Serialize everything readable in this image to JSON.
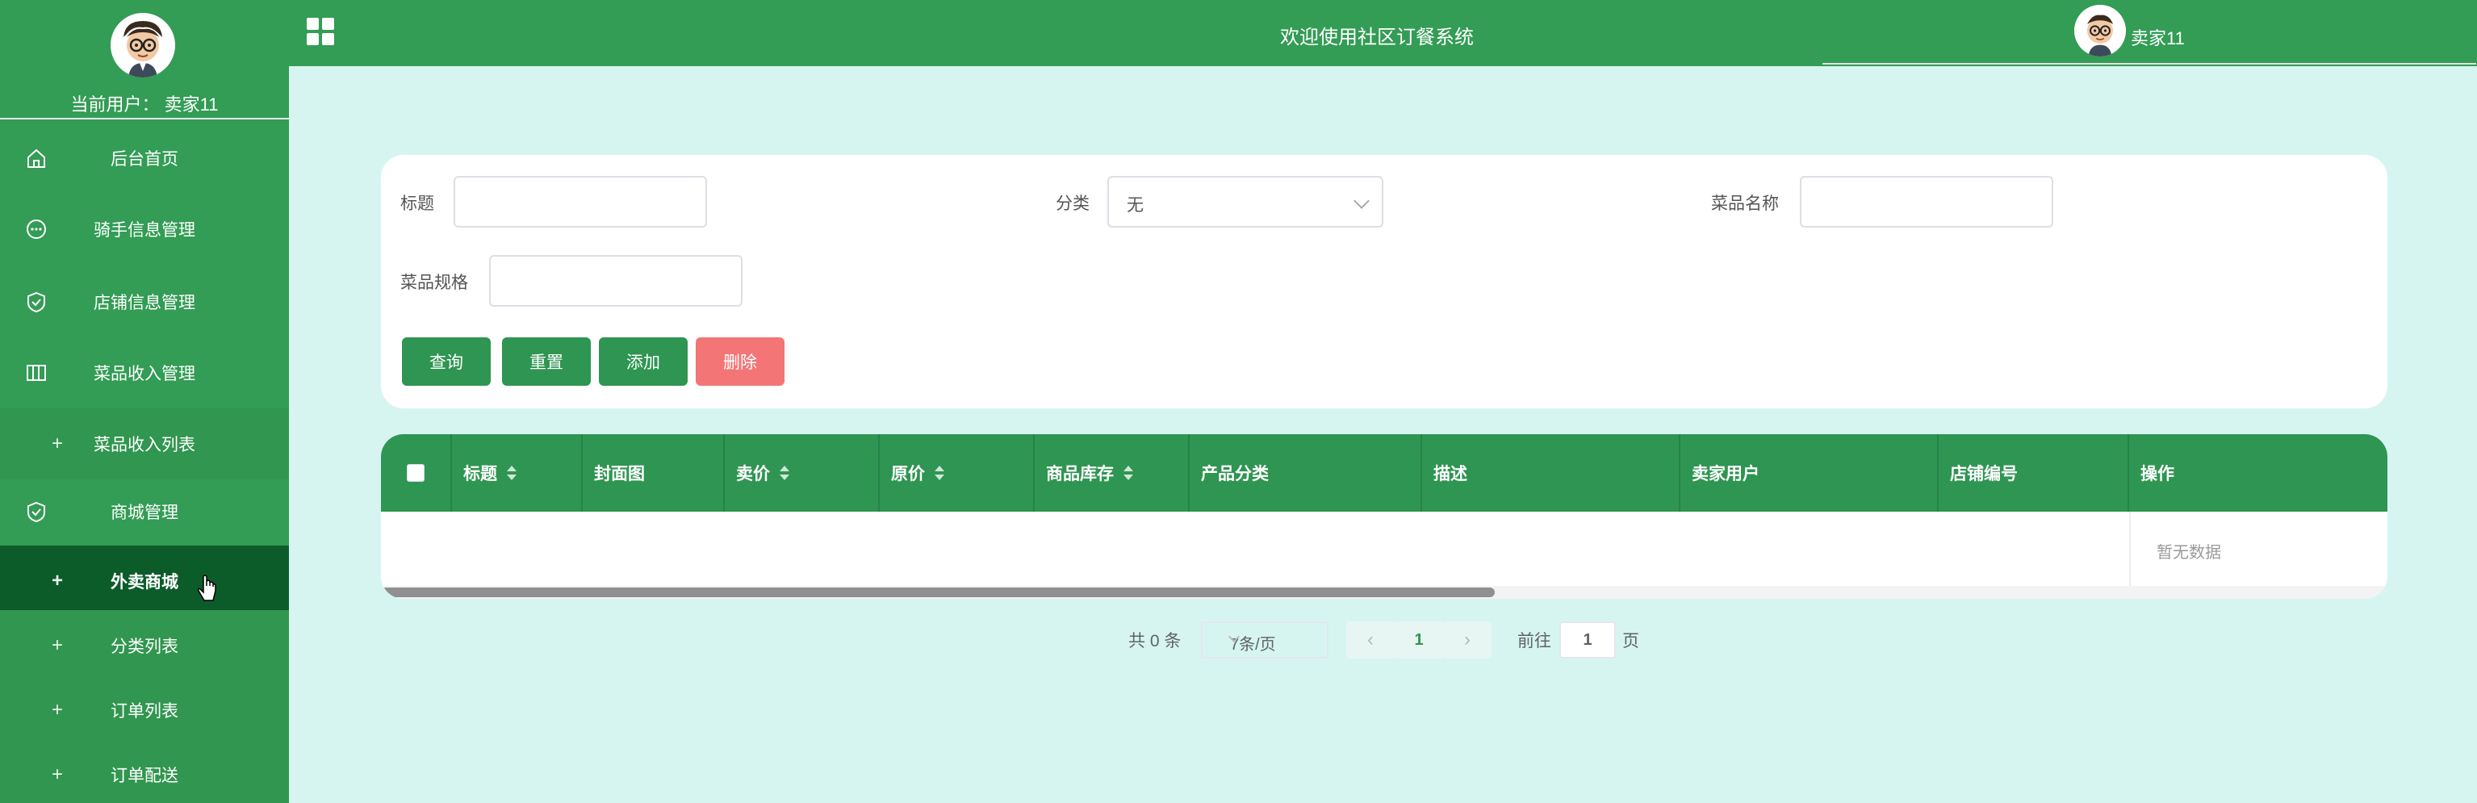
{
  "sidebar": {
    "current_user_label": "当前用户： 卖家11",
    "items": [
      {
        "label": "后台首页",
        "icon": "home-icon"
      },
      {
        "label": "骑手信息管理",
        "icon": "chat-icon"
      },
      {
        "label": "店铺信息管理",
        "icon": "shield-check-icon"
      },
      {
        "label": "菜品收入管理",
        "icon": "columns-icon"
      },
      {
        "label": "菜品收入列表",
        "icon": "plus-icon"
      },
      {
        "label": "商城管理",
        "icon": "shield-check-icon"
      },
      {
        "label": "外卖商城",
        "icon": "plus-icon"
      },
      {
        "label": "分类列表",
        "icon": "plus-icon"
      },
      {
        "label": "订单列表",
        "icon": "plus-icon"
      },
      {
        "label": "订单配送",
        "icon": "plus-icon"
      }
    ]
  },
  "header": {
    "title": "欢迎使用社区订餐系统",
    "username": "卖家11"
  },
  "search": {
    "title_label": "标题",
    "category_label": "分类",
    "category_value": "无",
    "dish_name_label": "菜品名称",
    "dish_spec_label": "菜品规格",
    "query_button": "查询",
    "reset_button": "重置",
    "add_button": "添加",
    "delete_button": "删除"
  },
  "table": {
    "columns": [
      "标题",
      "封面图",
      "卖价",
      "原价",
      "商品库存",
      "产品分类",
      "描述",
      "卖家用户",
      "店铺编号",
      "操作"
    ],
    "empty_text": "暂无数据"
  },
  "pagination": {
    "total": "共 0 条",
    "page_size": "7条/页",
    "current_page": "1",
    "goto_label": "前往",
    "goto_value": "1",
    "page_suffix": "页"
  },
  "colors": {
    "primary": "#339c55",
    "active": "#0c5c2a",
    "background": "#d6f5f1",
    "danger": "#f37575"
  }
}
